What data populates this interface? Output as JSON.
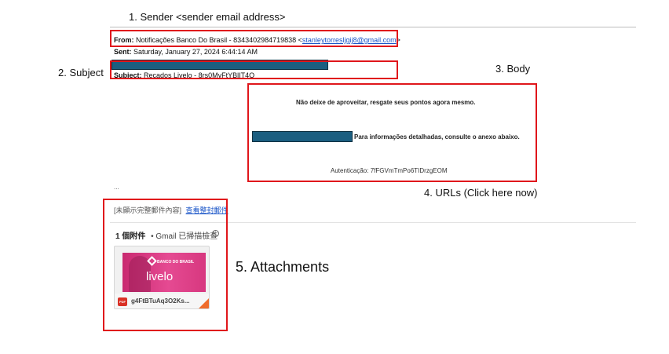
{
  "annotations": {
    "sender": "1. Sender <sender email address>",
    "subject": "2. Subject",
    "body": "3. Body",
    "urls": "4. URLs (Click here now)",
    "attachments": "5. Attachments"
  },
  "email": {
    "from_label": "From:",
    "from_name": "Notificações Banco Do Brasil - 8343402984719838 <",
    "from_email": "stanleytorresljgij8@gmail.com",
    "from_close": ">",
    "sent_label": "Sent:",
    "sent_value": "Saturday, January 27, 2024 6:44:14 AM",
    "subject_label": "Subject:",
    "subject_value": "Recados Livelo - 8rs0MyFtYBlIT4O"
  },
  "body": {
    "line1": "Não deixe de aproveitar, resgate seus pontos agora mesmo.",
    "line2": "Para informações detalhadas, consulte o anexo abaixo.",
    "auth": "Autenticação: 7fFGVmTmPo6TIDrzgEOM"
  },
  "gmail": {
    "ellipsis": "...",
    "truncated_note": "[未顯示完整郵件內容]",
    "view_full_link": "查看整封郵件",
    "attachment_count": "1 個附件",
    "scan_note": "• Gmail 已掃描檢查",
    "attachment": {
      "filename": "g4FtBTuAq3O2Ks...",
      "type_badge": "PDF",
      "thumb_brand": "BANCO DO BRASIL",
      "thumb_logo": "livelo"
    }
  },
  "colors": {
    "highlight": "#e0161b",
    "redaction": "#1b5e80",
    "link": "#1a55c8",
    "thumb_pink": "#d4347a"
  },
  "icons": {
    "pdf": "pdf-file-icon",
    "info": "info-icon"
  }
}
